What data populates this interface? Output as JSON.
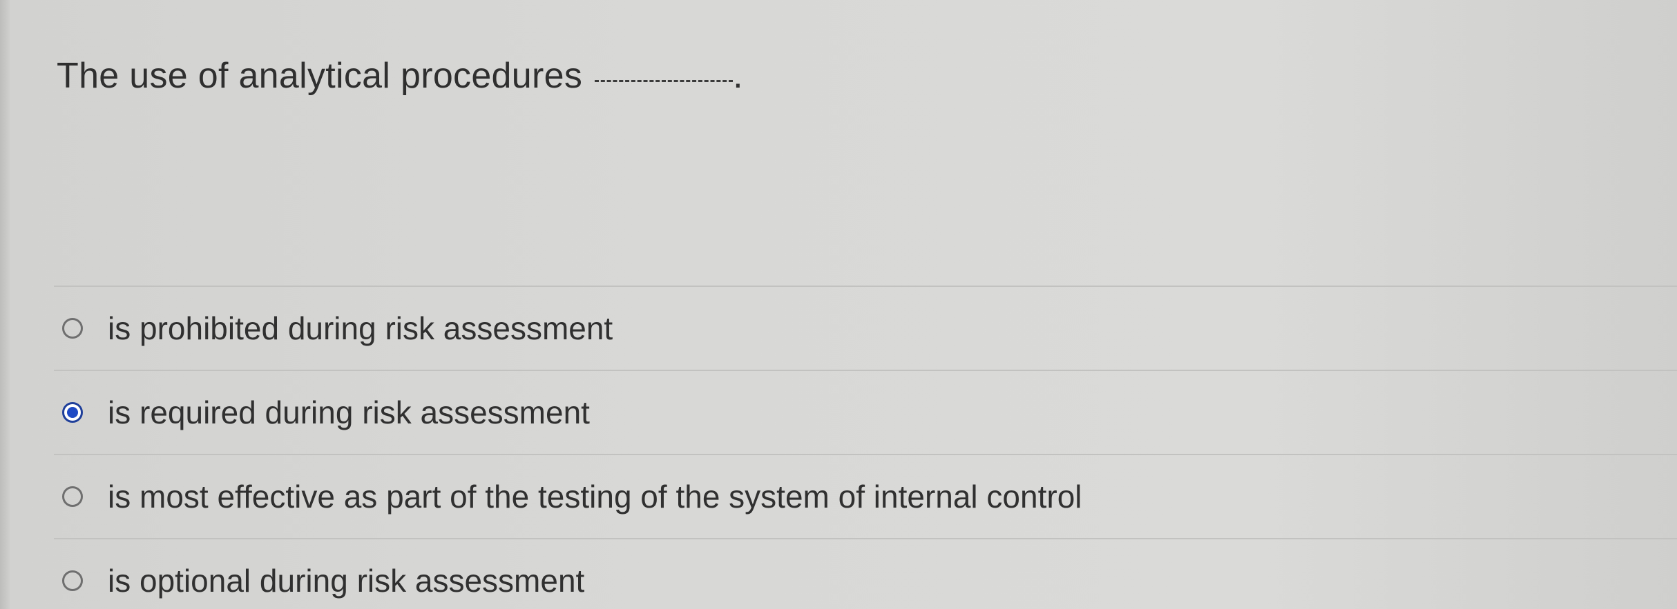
{
  "question": {
    "text": "The use of analytical procedures",
    "trailing": "."
  },
  "options": [
    {
      "label": "is prohibited during risk assessment",
      "selected": false
    },
    {
      "label": "is required during risk assessment",
      "selected": true
    },
    {
      "label": "is most effective as part of the testing of the system of internal control",
      "selected": false
    },
    {
      "label": "is optional during risk assessment",
      "selected": false
    }
  ],
  "colors": {
    "selected_radio": "#1e49c4",
    "text": "#303030"
  }
}
